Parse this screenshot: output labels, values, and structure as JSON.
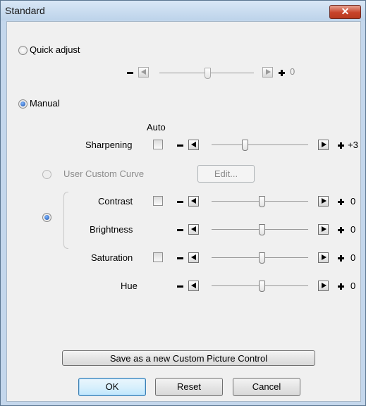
{
  "window": {
    "title": "Standard",
    "close_glyph": "✕"
  },
  "quick_adjust": {
    "label": "Quick adjust",
    "value": "0"
  },
  "manual": {
    "label": "Manual"
  },
  "auto_label": "Auto",
  "sharpening": {
    "label": "Sharpening",
    "value": "+3"
  },
  "user_custom_curve": {
    "label": "User Custom Curve",
    "edit_button": "Edit..."
  },
  "contrast": {
    "label": "Contrast",
    "value": "0"
  },
  "brightness": {
    "label": "Brightness",
    "value": "0"
  },
  "saturation": {
    "label": "Saturation",
    "value": "0"
  },
  "hue": {
    "label": "Hue",
    "value": "0"
  },
  "buttons": {
    "save_custom": "Save as a new Custom Picture Control",
    "ok": "OK",
    "reset": "Reset",
    "cancel": "Cancel"
  },
  "colors": {
    "accent": "#1a4fa8",
    "title_bar": "#c4d7ec",
    "close_button": "#c7432a"
  }
}
